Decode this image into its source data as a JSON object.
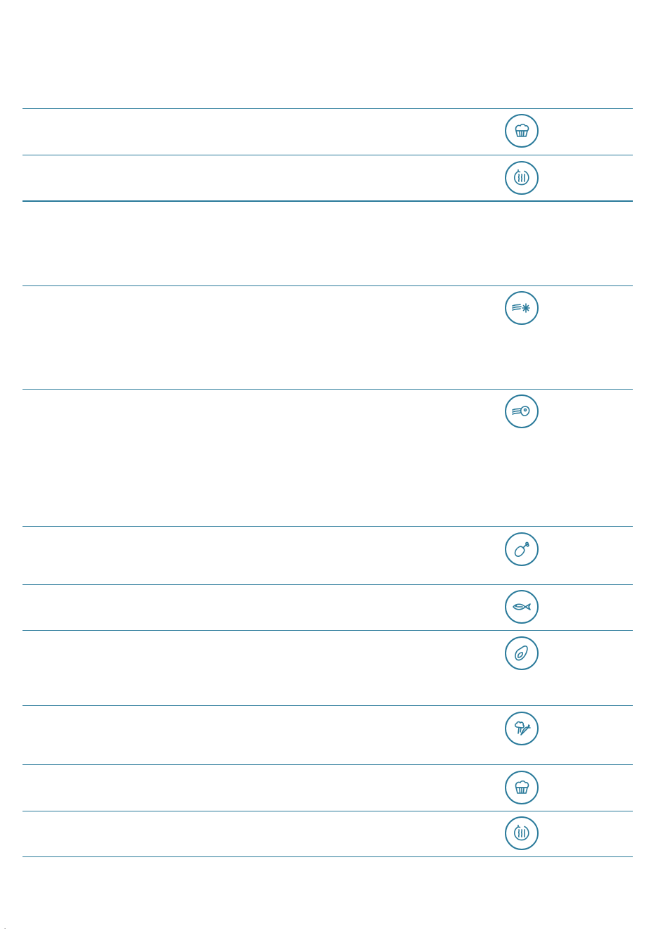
{
  "colors": {
    "accent": "#2a7a9a",
    "background": "#ffffff"
  },
  "page_mark": ".",
  "rows": [
    {
      "icon": "muffin-icon"
    },
    {
      "icon": "rotating-steam-icon"
    },
    {
      "icon": "none"
    },
    {
      "icon": "defrost-fan-snowflake-icon"
    },
    {
      "icon": "fan-meat-icon"
    },
    {
      "icon": "chicken-leg-icon"
    },
    {
      "icon": "fish-icon"
    },
    {
      "icon": "meat-roast-icon"
    },
    {
      "icon": "vegetables-icon"
    },
    {
      "icon": "muffin-icon"
    },
    {
      "icon": "rotating-steam-icon"
    }
  ]
}
